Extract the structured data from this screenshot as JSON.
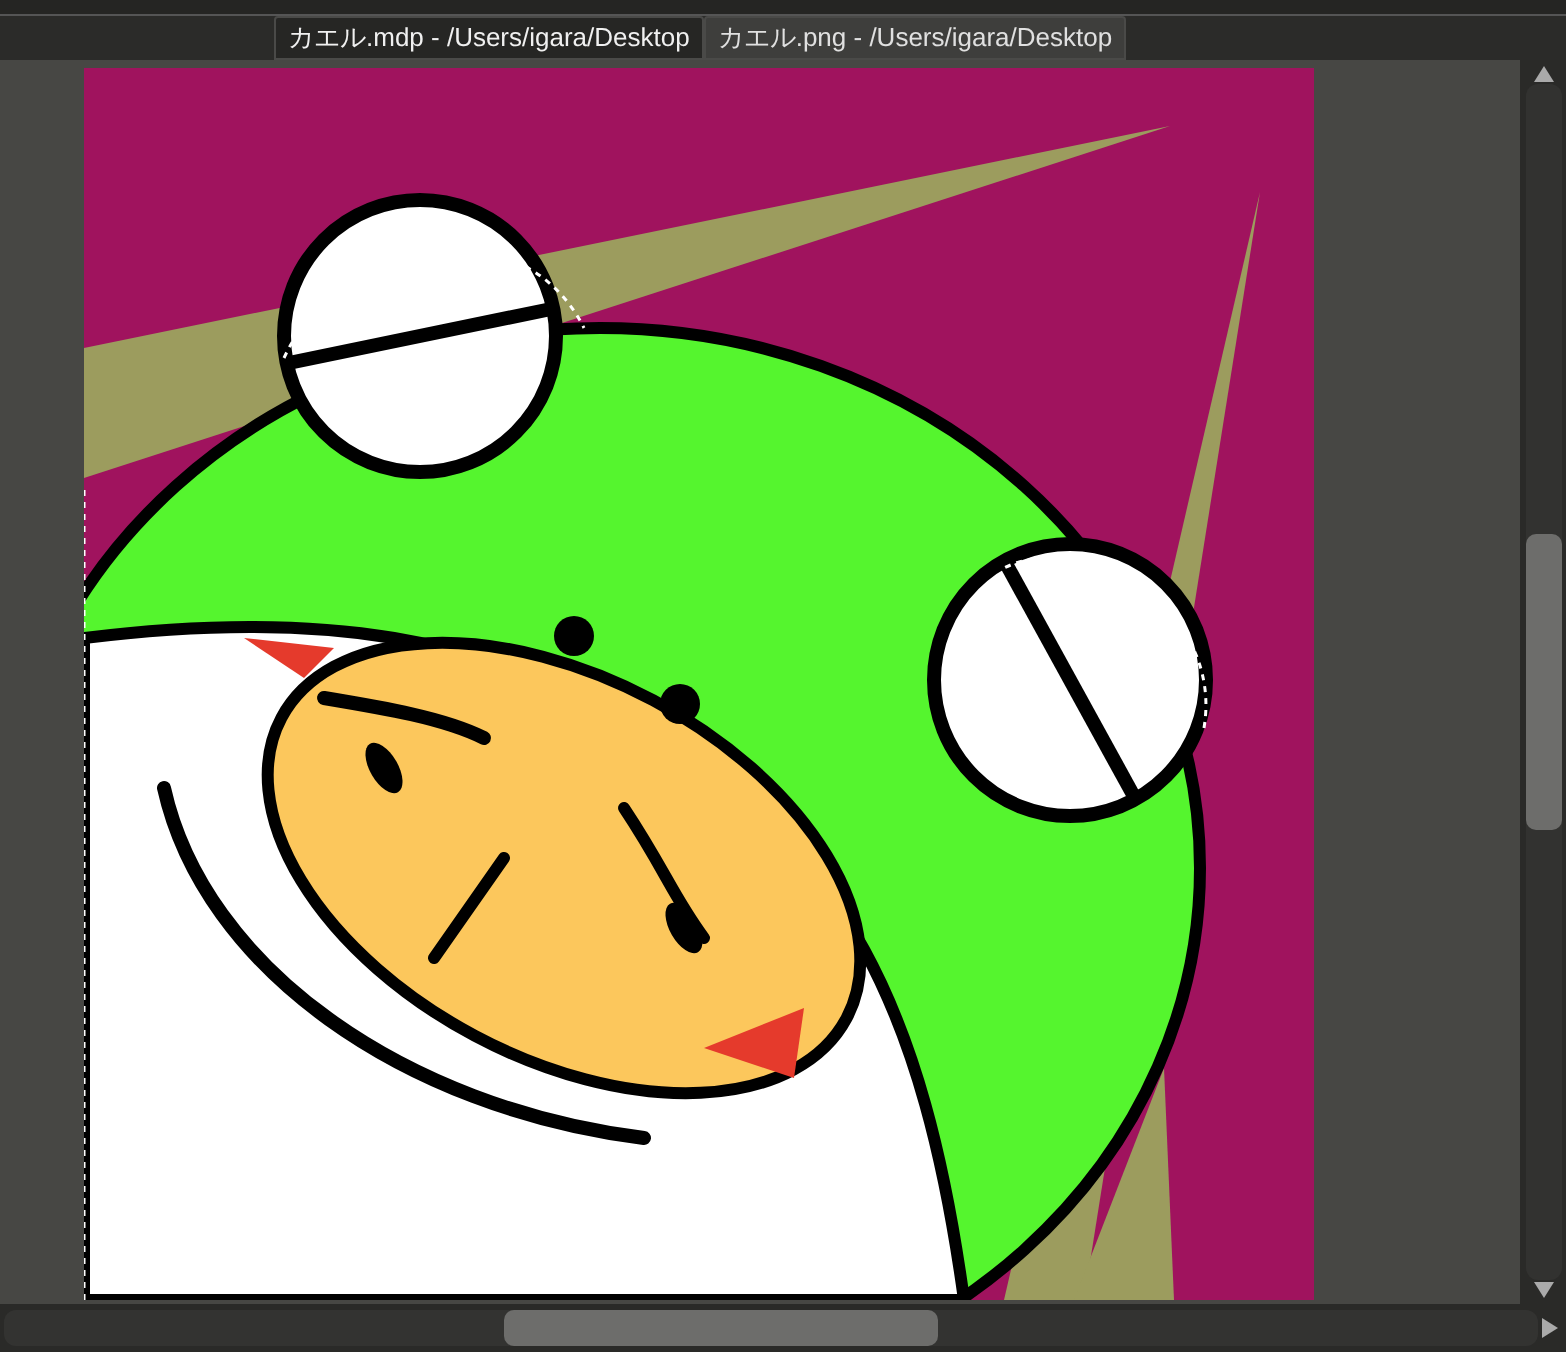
{
  "tabs": [
    {
      "label": "カエル.mdp - /Users/igara/Desktop",
      "selected": false
    },
    {
      "label": "カエル.png - /Users/igara/Desktop",
      "selected": true
    }
  ]
}
